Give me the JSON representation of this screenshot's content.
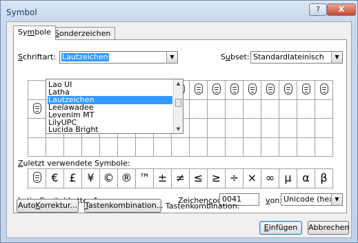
{
  "window": {
    "title": "Symbol",
    "help_label": "?",
    "close_label": "X"
  },
  "tabs": [
    {
      "label_pre": "Sy",
      "label_u": "m",
      "label_post": "bole"
    },
    {
      "label_pre": "",
      "label_u": "S",
      "label_post": "onderzeichen"
    }
  ],
  "font_select": {
    "label_pre": "",
    "label_u": "S",
    "label_post": "chriftart:",
    "value": "Lautzeichen"
  },
  "subset_select": {
    "label_pre": "S",
    "label_u": "u",
    "label_post": "bset:",
    "value": "Standardlateinisch"
  },
  "font_list": {
    "items": [
      "Lao UI",
      "Latha",
      "Lautzeichen",
      "Leelawadee",
      "Levenim MT",
      "LilyUPC",
      "Lucida Bright"
    ],
    "selected_index": 2
  },
  "recent": {
    "label_pre": "",
    "label_u": "Z",
    "label_post": "uletzt verwendete Symbole:",
    "symbols": [
      "€",
      "£",
      "¥",
      "©",
      "®",
      "™",
      "±",
      "≠",
      "≤",
      "≥",
      "÷",
      "×",
      "∞",
      "µ",
      "α",
      "β"
    ]
  },
  "char_name": "Latin Capital Letter A",
  "char_code": {
    "label_pre": "Zeichen",
    "label_u": "c",
    "label_post": "ode:",
    "value": "0041"
  },
  "from_select": {
    "label_pre": "",
    "label_u": "v",
    "label_post": "on:",
    "value": "Unicode (hex)"
  },
  "buttons": {
    "autocorrect_pre": "Auto",
    "autocorrect_u": "K",
    "autocorrect_post": "orrektur...",
    "shortcut_pre": "",
    "shortcut_u": "T",
    "shortcut_post": "astenkombination...",
    "shortcut_label": "Tastenkombination:",
    "insert_pre": "",
    "insert_u": "E",
    "insert_post": "infügen",
    "cancel": "Abbrechen"
  },
  "icons": {
    "face": "face-glyph-icon",
    "dropdown": "chevron-down-icon"
  }
}
